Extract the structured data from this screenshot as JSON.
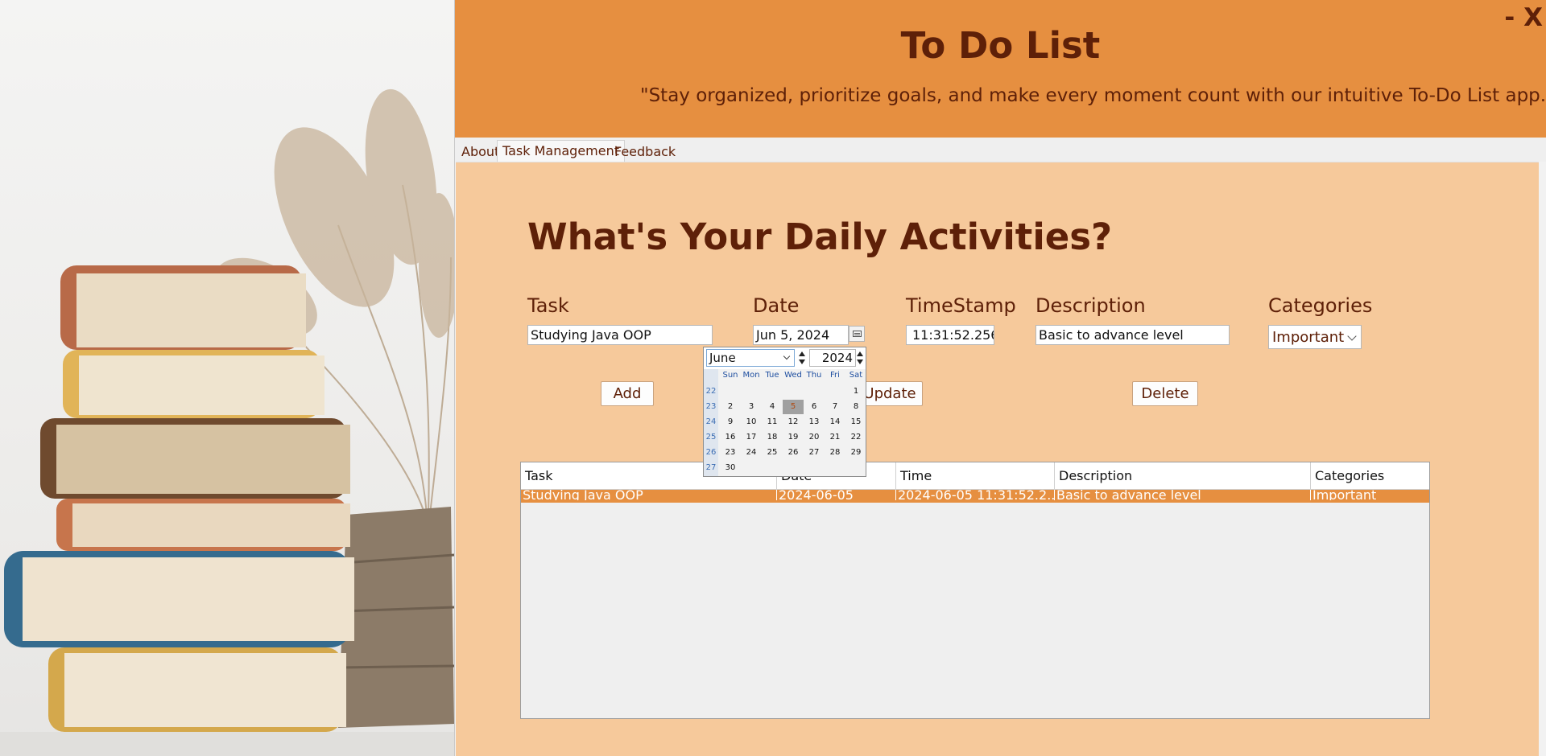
{
  "header": {
    "title": "To Do List",
    "tagline": "\"Stay organized, prioritize goals, and make every moment count with our intuitive To-Do List app.\"",
    "minimize_label": "-",
    "close_label": "X",
    "color": "#e68f40"
  },
  "tabs": [
    {
      "label": "About"
    },
    {
      "label": "Task Management",
      "active": true
    },
    {
      "label": "Feedback"
    }
  ],
  "panel": {
    "heading": "What's Your Daily Activities?",
    "color": "#f6c99b"
  },
  "form": {
    "task_label": "Task",
    "task_value": "Studying Java OOP",
    "date_label": "Date",
    "date_value": "Jun 5, 2024",
    "timestamp_label": "TimeStamp",
    "timestamp_value": "11:31:52.256",
    "description_label": "Description",
    "description_value": "Basic to advance level",
    "categories_label": "Categories",
    "category_value": "Important"
  },
  "buttons": {
    "add": "Add",
    "update": "Update",
    "delete": "Delete"
  },
  "table": {
    "columns": [
      "Task",
      "Date",
      "Time",
      "Description",
      "Categories"
    ],
    "rows": [
      [
        "Studying Java OOP",
        "2024-06-05",
        "2024-06-05 11:31:52.2...",
        "Basic to advance level",
        "Important"
      ]
    ],
    "selected_row_color": "#e68f40"
  },
  "calendar": {
    "month": "June",
    "year": "2024",
    "day_headers": [
      "Sun",
      "Mon",
      "Tue",
      "Wed",
      "Thu",
      "Fri",
      "Sat"
    ],
    "week_numbers": [
      "22",
      "23",
      "24",
      "25",
      "26",
      "27"
    ],
    "weeks": [
      [
        "",
        "",
        "",
        "",
        "",
        "",
        "1"
      ],
      [
        "2",
        "3",
        "4",
        "5",
        "6",
        "7",
        "8"
      ],
      [
        "9",
        "10",
        "11",
        "12",
        "13",
        "14",
        "15"
      ],
      [
        "16",
        "17",
        "18",
        "19",
        "20",
        "21",
        "22"
      ],
      [
        "23",
        "24",
        "25",
        "26",
        "27",
        "28",
        "29"
      ],
      [
        "30",
        "",
        "",
        "",
        "",
        "",
        ""
      ]
    ],
    "selected_day": "5"
  }
}
